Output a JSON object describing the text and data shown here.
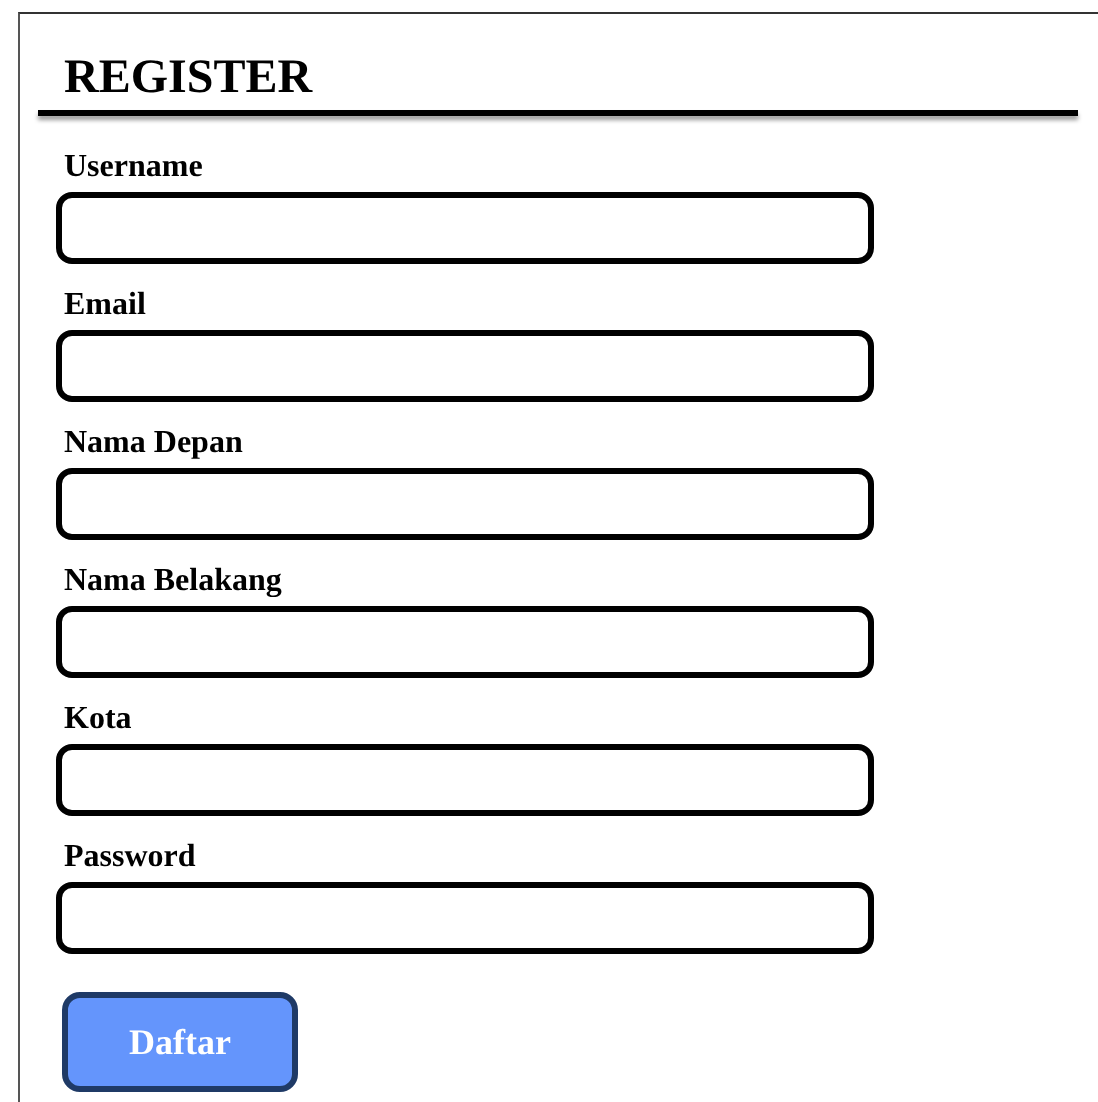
{
  "title": "REGISTER",
  "fields": [
    {
      "label": "Username"
    },
    {
      "label": "Email"
    },
    {
      "label": "Nama Depan"
    },
    {
      "label": "Nama Belakang"
    },
    {
      "label": "Kota"
    },
    {
      "label": "Password"
    }
  ],
  "submit": "Daftar"
}
